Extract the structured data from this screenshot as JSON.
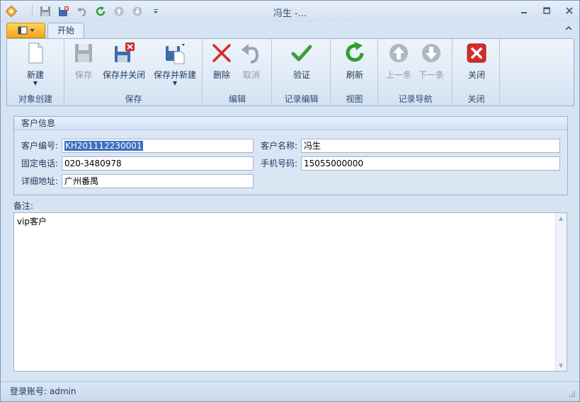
{
  "window": {
    "title": "冯生 -..."
  },
  "quick_access": [
    "save-icon",
    "save-close-icon",
    "undo-icon",
    "refresh-icon",
    "up-icon",
    "down-icon",
    "customize-icon"
  ],
  "tabs": [
    {
      "label": "开始"
    }
  ],
  "ribbon": {
    "groups": [
      {
        "label": "对象创建",
        "buttons": [
          {
            "label": "新建",
            "icon": "new-document-icon",
            "enabled": true,
            "dropdown": true
          }
        ]
      },
      {
        "label": "保存",
        "buttons": [
          {
            "label": "保存",
            "icon": "save-icon",
            "enabled": false
          },
          {
            "label": "保存并关闭",
            "icon": "save-close-icon",
            "enabled": true
          },
          {
            "label": "保存并新建",
            "icon": "save-new-icon",
            "enabled": true,
            "dropdown": true
          }
        ]
      },
      {
        "label": "编辑",
        "buttons": [
          {
            "label": "删除",
            "icon": "delete-icon",
            "enabled": true
          },
          {
            "label": "取消",
            "icon": "undo-icon",
            "enabled": false
          }
        ]
      },
      {
        "label": "记录编辑",
        "buttons": [
          {
            "label": "验证",
            "icon": "check-icon",
            "enabled": true
          }
        ]
      },
      {
        "label": "视图",
        "buttons": [
          {
            "label": "刷新",
            "icon": "refresh-icon",
            "enabled": true
          }
        ]
      },
      {
        "label": "记录导航",
        "buttons": [
          {
            "label": "上一条",
            "icon": "previous-icon",
            "enabled": false
          },
          {
            "label": "下一条",
            "icon": "next-icon",
            "enabled": false
          }
        ]
      },
      {
        "label": "关闭",
        "buttons": [
          {
            "label": "关闭",
            "icon": "close-icon",
            "enabled": true
          }
        ]
      }
    ]
  },
  "customer": {
    "section_title": "客户信息",
    "code_label": "客户编号:",
    "code_value": "KH201112230001",
    "name_label": "客户名称:",
    "name_value": "冯生",
    "phone_label": "固定电话:",
    "phone_value": "020-3480978",
    "mobile_label": "手机号码:",
    "mobile_value": "15055000000",
    "address_label": "详细地址:",
    "address_value": "广州番禺"
  },
  "remark": {
    "label": "备注:",
    "value": "vip客户"
  },
  "status": {
    "text": "登录账号: admin"
  },
  "colors": {
    "accent": "#f2a51c",
    "ribbon_border": "#99b1d2",
    "selection": "#3a6fc0"
  }
}
